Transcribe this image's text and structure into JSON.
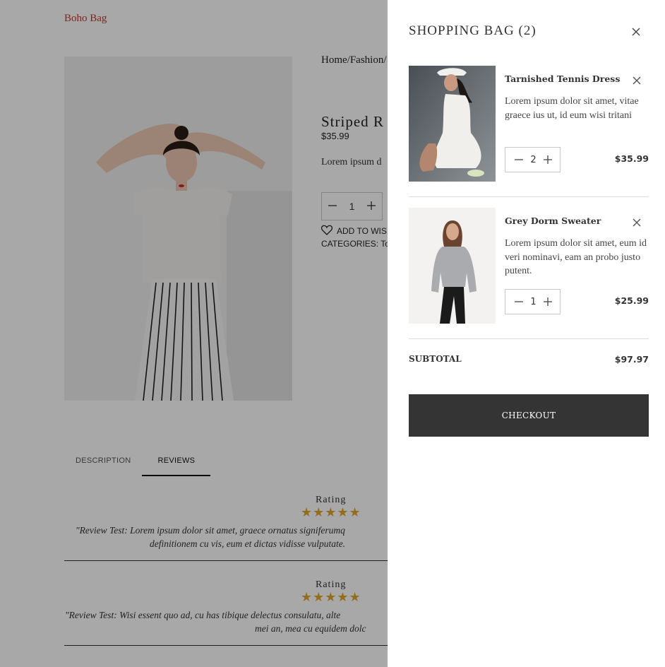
{
  "page": {
    "brand": "Boho Bag",
    "breadcrumb": "Home/Fashion/",
    "product_title": "Striped R",
    "product_price": "$35.99",
    "product_desc": "Lorem ipsum d",
    "quantity": "1",
    "wishlist_label": "ADD TO WIS",
    "categories": "CATEGORIES: To",
    "tabs": [
      {
        "label": "DESCRIPTION"
      },
      {
        "label": "REVIEWS"
      }
    ],
    "reviews": [
      {
        "heading": "Rating",
        "stars": "★★★★★",
        "line1": "\"Review Test: Lorem ipsum dolor sit amet, graece ornatus signiferumq",
        "line2": "definitionem cu vis, eum et dictas vidisse vulputate."
      },
      {
        "heading": "Rating",
        "stars": "★★★★★",
        "line1": "\"Review Test: Wisi essent quo ad, cu has tibique delectus consulatu, alte",
        "line2": "mei an, mea cu equidem dolc"
      }
    ]
  },
  "cart": {
    "title": "SHOPPING BAG (2)",
    "items": [
      {
        "name": "Tarnished Tennis Dress",
        "description": "Lorem ipsum dolor sit amet, vitae graece ius ut, id eum wisi tritani",
        "quantity": "2",
        "price": "$35.99"
      },
      {
        "name": "Grey Dorm Sweater",
        "description": "Lorem ipsum dolor sit amet, eum id veri nominavi, eam an probo justo putent.",
        "quantity": "1",
        "price": "$25.99"
      }
    ],
    "subtotal_label": "SUBTOTAL",
    "subtotal_value": "$97.97",
    "checkout_label": "CHECKOUT"
  },
  "icons": {
    "close": "close-icon",
    "minus": "minus-icon",
    "plus": "plus-icon",
    "heart": "heart-icon",
    "star": "star-icon"
  },
  "colors": {
    "brand": "#c0392b",
    "star": "#e0a52b",
    "checkout_bg": "#343434",
    "overlay": "rgba(0,0,0,0.34)"
  }
}
